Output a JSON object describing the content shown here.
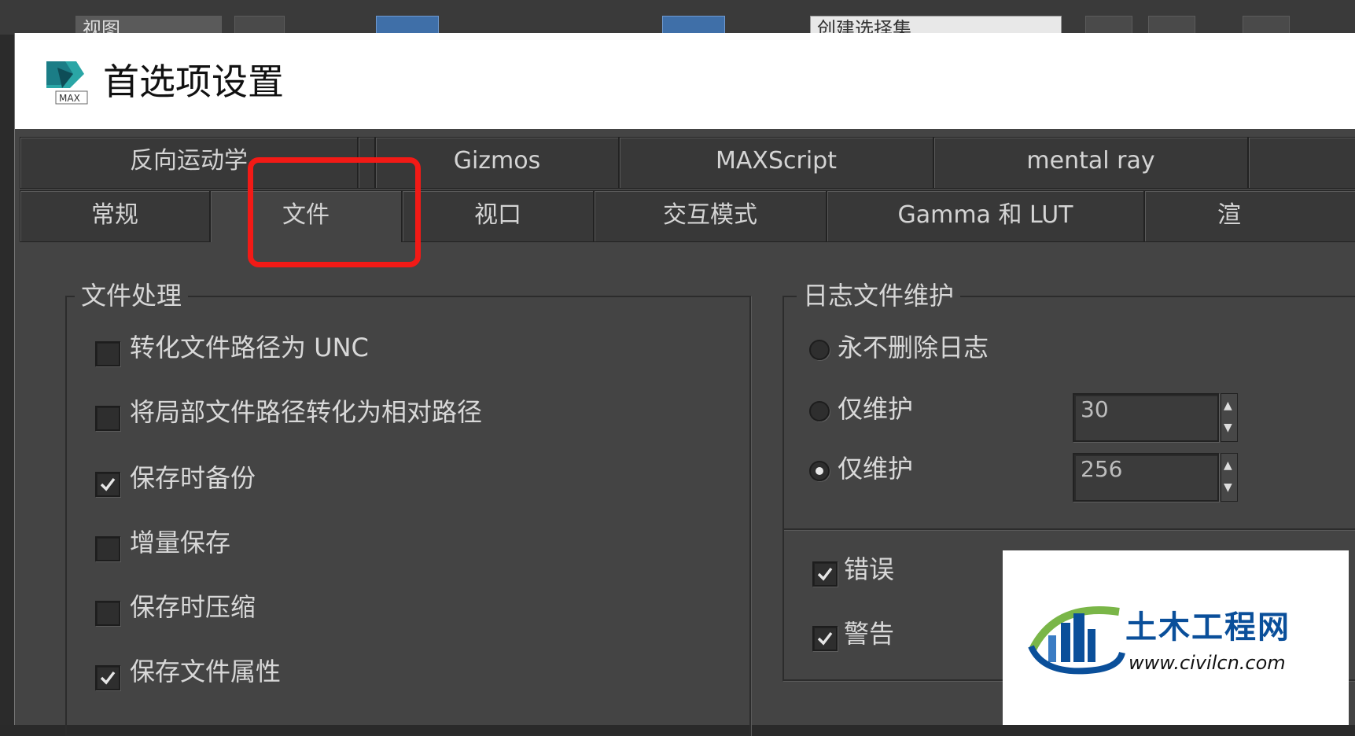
{
  "background_app": {
    "toolbar": {
      "view_dropdown": "视图",
      "selection_set": "创建选择集"
    }
  },
  "dialog": {
    "title": "首选项设置",
    "tabs_row1": [
      "反向运动学",
      "Gizmos",
      "MAXScript",
      "mental ray"
    ],
    "tabs_row2": [
      "常规",
      "文件",
      "视口",
      "交互模式",
      "Gamma 和 LUT",
      "渲"
    ],
    "active_tab": "文件",
    "file_handling": {
      "title": "文件处理",
      "options": [
        {
          "label": "转化文件路径为 UNC",
          "checked": false
        },
        {
          "label": "将局部文件路径转化为相对路径",
          "checked": false
        },
        {
          "label": "保存时备份",
          "checked": true
        },
        {
          "label": "增量保存",
          "checked": false
        },
        {
          "label": "保存时压缩",
          "checked": false
        },
        {
          "label": "保存文件属性",
          "checked": true
        }
      ]
    },
    "log_maintenance": {
      "title": "日志文件维护",
      "never_delete": {
        "label": "永不删除日志",
        "selected": false
      },
      "keep_days": {
        "label": "仅维护",
        "selected": false,
        "value": "30"
      },
      "keep_size": {
        "label": "仅维护",
        "selected": true,
        "value": "256"
      },
      "errors": {
        "label": "错误",
        "checked": true
      },
      "warnings": {
        "label": "警告",
        "checked": true
      }
    }
  },
  "watermark": {
    "name": "土木工程网",
    "url": "www.civilcn.com"
  },
  "colors": {
    "highlight": "#f21a16",
    "panel": "#444444",
    "watermark_blue": "#0a4f9a",
    "watermark_green": "#7ab648"
  }
}
